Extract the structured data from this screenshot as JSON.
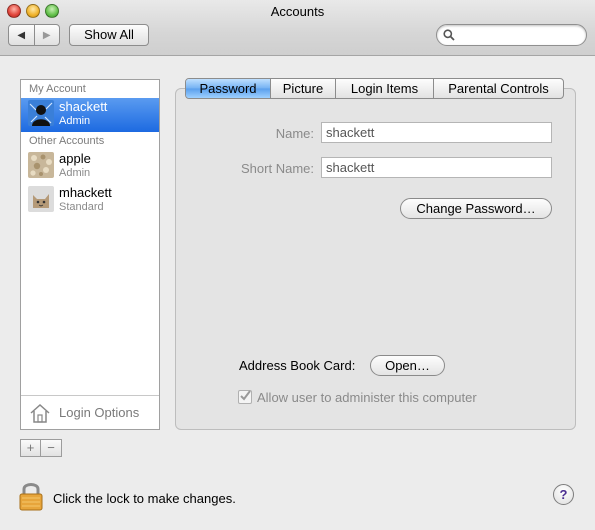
{
  "window": {
    "title": "Accounts"
  },
  "toolbar": {
    "back_glyph": "◀",
    "forward_glyph": "▶",
    "show_all_label": "Show All",
    "search_placeholder": ""
  },
  "sidebar": {
    "my_account_header": "My Account",
    "other_accounts_header": "Other Accounts",
    "my_account": {
      "name": "shackett",
      "role": "Admin",
      "icon": "user-silhouette-icon"
    },
    "other_accounts": [
      {
        "name": "apple",
        "role": "Admin",
        "icon": "stone-texture-icon"
      },
      {
        "name": "mhackett",
        "role": "Standard",
        "icon": "cat-icon"
      }
    ],
    "login_options_label": "Login Options",
    "add_glyph": "+",
    "remove_glyph": "−"
  },
  "tabs": [
    {
      "label": "Password",
      "active": true
    },
    {
      "label": "Picture",
      "active": false
    },
    {
      "label": "Login Items",
      "active": false
    },
    {
      "label": "Parental Controls",
      "active": false
    }
  ],
  "password_pane": {
    "name_label": "Name:",
    "name_value": "shackett",
    "short_name_label": "Short Name:",
    "short_name_value": "shackett",
    "change_password_label": "Change Password…",
    "address_book_label": "Address Book Card:",
    "open_button_label": "Open…",
    "allow_admin_label": "Allow user to administer this computer",
    "allow_admin_checked": true
  },
  "footer": {
    "lock_text": "Click the lock to make changes.",
    "help_glyph": "?"
  },
  "colors": {
    "selection_blue": "#1d6ae1",
    "active_tab_blue": "#73b1f3",
    "window_bg": "#ececec"
  }
}
